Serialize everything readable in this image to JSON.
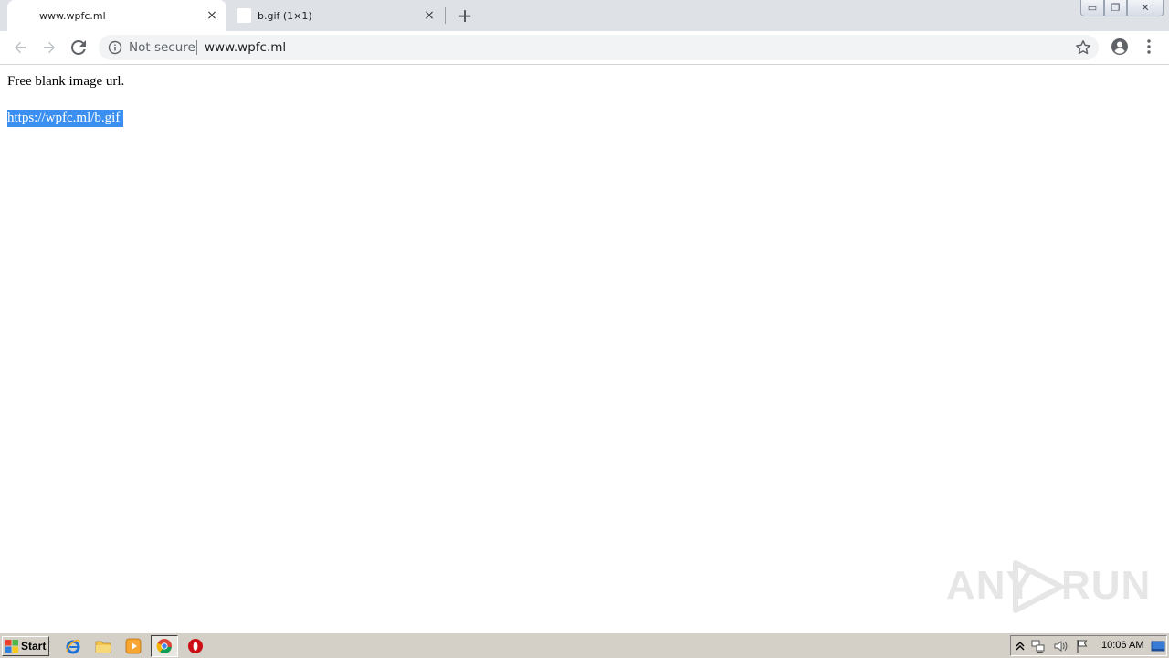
{
  "browser": {
    "tabs": [
      {
        "title": "www.wpfc.ml",
        "active": true
      },
      {
        "title": "b.gif (1×1)",
        "active": false
      }
    ],
    "new_tab_symbol": "+",
    "close_symbol": "×",
    "window_controls": {
      "minimize": "▭",
      "maximize": "❐",
      "close": "✕"
    },
    "security_label": "Not secure",
    "url": "www.wpfc.ml",
    "icons": [
      "back-arrow-icon",
      "forward-arrow-icon",
      "reload-icon",
      "info-icon",
      "bookmark-star-icon",
      "profile-icon",
      "menu-dots-icon"
    ]
  },
  "page": {
    "text": "Free blank image url.",
    "link": "https://wpfc.ml/b.gif"
  },
  "watermark": {
    "left": "ANY",
    "right": "RUN"
  },
  "taskbar": {
    "start_label": "Start",
    "apps": [
      "internet-explorer-icon",
      "file-explorer-icon",
      "media-player-icon",
      "chrome-icon",
      "opera-icon"
    ],
    "tray_icons": [
      "show-hidden-icons-icon",
      "network-icon",
      "volume-icon",
      "action-center-flag-icon",
      "show-desktop-icon"
    ],
    "clock": "10:06 AM"
  },
  "colors": {
    "tabstrip": "#dee1e6",
    "selection": "#3b8ff0",
    "taskbar": "#d4d0c8"
  }
}
